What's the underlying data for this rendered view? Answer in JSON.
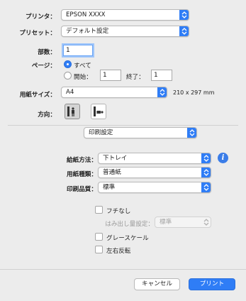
{
  "printer": {
    "label": "プリンタ：",
    "value": "EPSON XXXX"
  },
  "preset": {
    "label": "プリセット：",
    "value": "デフォルト設定"
  },
  "copies": {
    "label": "部数：",
    "value": "1"
  },
  "pages": {
    "label": "ページ：",
    "all_label": "すべて",
    "all_selected": true,
    "from_label": "開始：",
    "from_value": "1",
    "to_label": "終了：",
    "to_value": "1"
  },
  "paper_size": {
    "label": "用紙サイズ：",
    "value": "A4",
    "dims": "210 x 297 mm"
  },
  "orientation": {
    "label": "方向：",
    "selected": "portrait"
  },
  "panel": {
    "value": "印刷設定"
  },
  "paper_source": {
    "label": "給紙方法：",
    "value": "下トレイ",
    "info_icon": "i"
  },
  "media_type": {
    "label": "用紙種類：",
    "value": "普通紙"
  },
  "print_quality": {
    "label": "印刷品質：",
    "value": "標準"
  },
  "borderless": {
    "label": "フチなし",
    "checked": false
  },
  "expansion": {
    "label": "はみ出し量設定：",
    "value": "標準",
    "enabled": false
  },
  "grayscale": {
    "label": "グレースケール",
    "checked": false
  },
  "mirror": {
    "label": "左右反転",
    "checked": false
  },
  "buttons": {
    "cancel": "キャンセル",
    "print": "プリント"
  },
  "colors": {
    "accent": "#2f7df6",
    "background": "#ececec",
    "info": "#3b7de8"
  }
}
